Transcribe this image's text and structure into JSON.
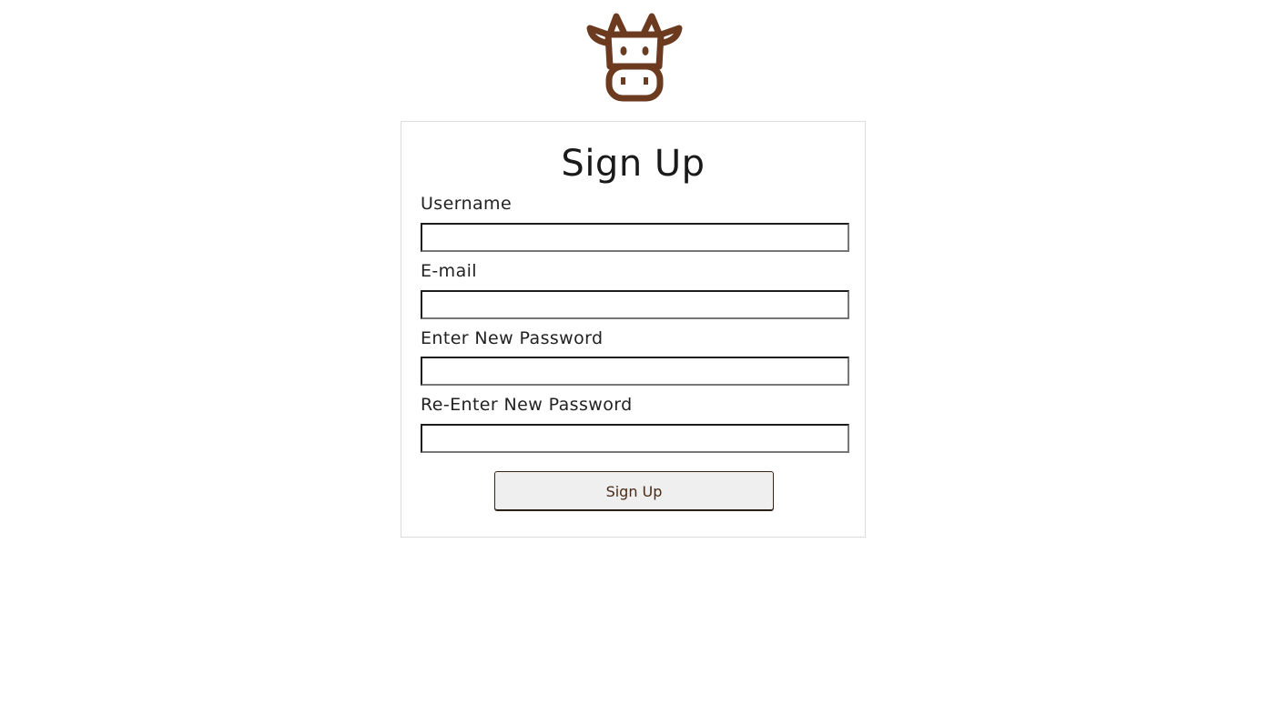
{
  "brand": {
    "logo_icon": "cow-head-icon",
    "logo_color": "#6b3a1f"
  },
  "signup_form": {
    "title": "Sign Up",
    "fields": [
      {
        "label": "Username",
        "value": "",
        "type": "text"
      },
      {
        "label": "E-mail",
        "value": "",
        "type": "email"
      },
      {
        "label": "Enter New Password",
        "value": "",
        "type": "password"
      },
      {
        "label": "Re-Enter New Password",
        "value": "",
        "type": "password"
      }
    ],
    "submit_label": "Sign Up"
  }
}
